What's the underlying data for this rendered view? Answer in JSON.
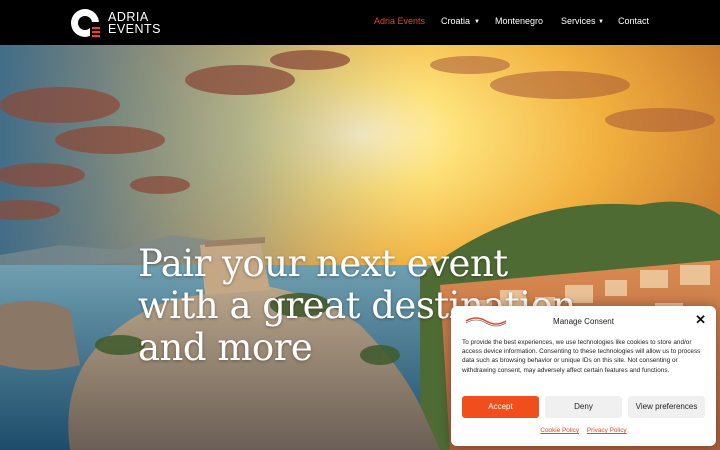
{
  "brand": {
    "line1": "ADRIA",
    "line2": "EVENTS"
  },
  "nav": {
    "items": [
      {
        "label": "Adria Events",
        "active": true,
        "dropdown": false
      },
      {
        "label": "Croatia",
        "active": false,
        "dropdown": true
      },
      {
        "label": "Montenegro",
        "active": false,
        "dropdown": false
      },
      {
        "label": "Services",
        "active": false,
        "dropdown": true
      },
      {
        "label": "Contact",
        "active": false,
        "dropdown": false
      }
    ],
    "colors": {
      "active": "#e8442a",
      "default": "#ffffff",
      "background": "#000000"
    }
  },
  "hero": {
    "headline": "Pair your next event with a great destination, and more"
  },
  "consent": {
    "title": "Manage Consent",
    "body": "To provide the best experiences, we use technologies like cookies to store and/or access device information. Consenting to these technologies will allow us to process data such as browsing behavior or unique IDs on this site. Not consenting or withdrawing consent, may adversely affect certain features and functions.",
    "accept_label": "Accept",
    "deny_label": "Deny",
    "prefs_label": "View preferences",
    "cookie_policy_label": "Cookie Policy",
    "privacy_policy_label": "Privacy Policy",
    "close_icon": "close-icon",
    "accent": "#f04e1c"
  }
}
